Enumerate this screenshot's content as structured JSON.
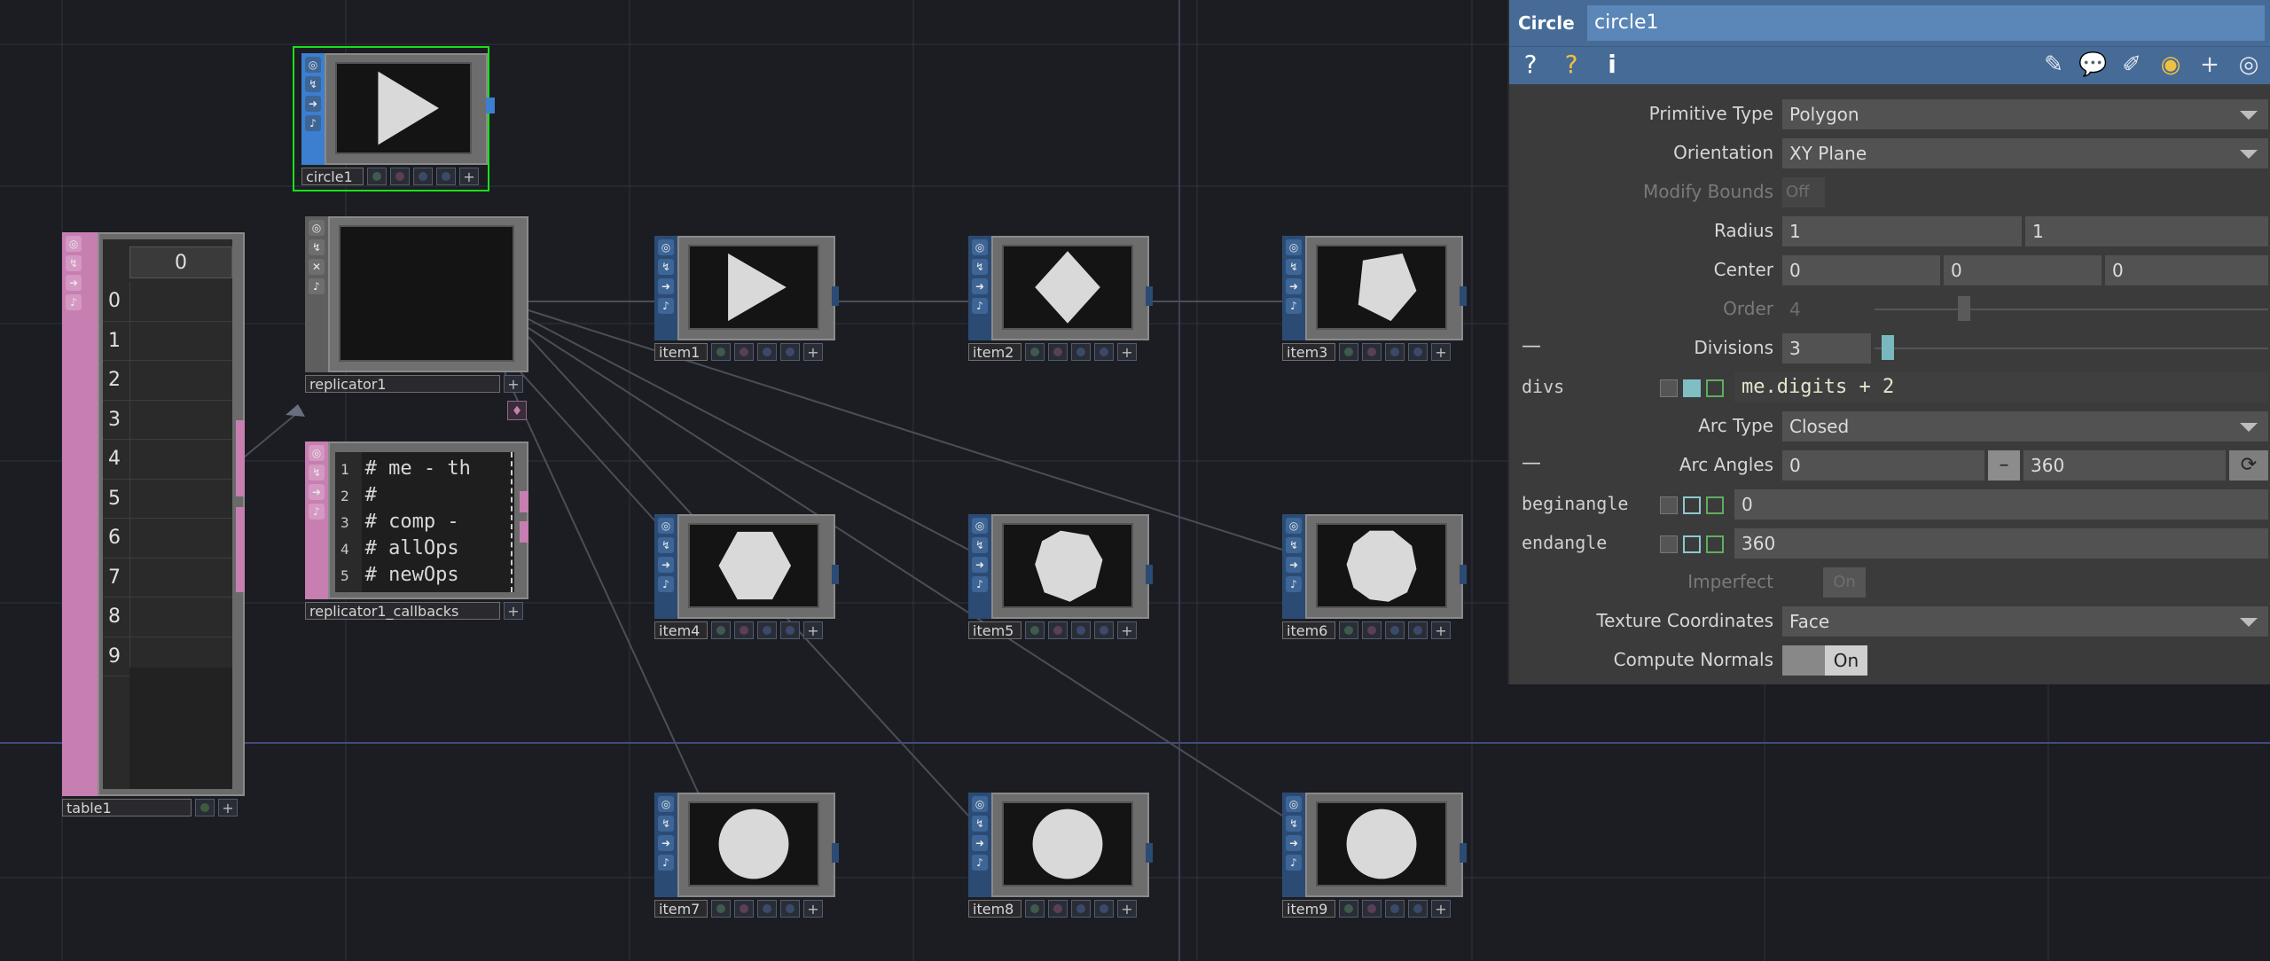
{
  "network": {
    "nodes": {
      "circle1": {
        "name": "circle1"
      },
      "replicator1": {
        "name": "replicator1"
      },
      "callbacks": {
        "name": "replicator1_callbacks",
        "lines": [
          {
            "num": "1",
            "text": "# me - th"
          },
          {
            "num": "2",
            "text": "#"
          },
          {
            "num": "3",
            "text": "# comp -"
          },
          {
            "num": "4",
            "text": "# allOps"
          },
          {
            "num": "5",
            "text": "# newOps"
          }
        ]
      },
      "table1": {
        "name": "table1",
        "header": "0",
        "rows": [
          "0",
          "1",
          "2",
          "3",
          "4",
          "5",
          "6",
          "7",
          "8",
          "9"
        ]
      },
      "items": [
        {
          "name": "item1",
          "shape": "triangle"
        },
        {
          "name": "item2",
          "shape": "diamond"
        },
        {
          "name": "item3",
          "shape": "pentagon"
        },
        {
          "name": "item4",
          "shape": "hexagon"
        },
        {
          "name": "item5",
          "shape": "heptagon"
        },
        {
          "name": "item6",
          "shape": "octagon"
        },
        {
          "name": "item7",
          "shape": "nonagon"
        },
        {
          "name": "item8",
          "shape": "decagon"
        },
        {
          "name": "item9",
          "shape": "hendecagon"
        }
      ]
    }
  },
  "params": {
    "op_type": "Circle",
    "op_name": "circle1",
    "toolbar": {
      "help": "?",
      "python_help": "?",
      "info": "i"
    },
    "primitive_type": {
      "label": "Primitive Type",
      "value": "Polygon"
    },
    "orientation": {
      "label": "Orientation",
      "value": "XY Plane"
    },
    "modify_bounds": {
      "label": "Modify Bounds",
      "value": "Off"
    },
    "radius": {
      "label": "Radius",
      "x": "1",
      "y": "1"
    },
    "center": {
      "label": "Center",
      "x": "0",
      "y": "0",
      "z": "0"
    },
    "order": {
      "label": "Order",
      "value": "4"
    },
    "divisions": {
      "label": "Divisions",
      "value": "3",
      "expr_name": "divs",
      "expr": "me.digits + 2"
    },
    "arc_type": {
      "label": "Arc Type",
      "value": "Closed"
    },
    "arc_angles": {
      "label": "Arc Angles",
      "begin": "0",
      "end": "360",
      "begin_name": "beginangle",
      "begin_expr": "0",
      "end_name": "endangle",
      "end_expr": "360"
    },
    "imperfect": {
      "label": "Imperfect",
      "value": "On"
    },
    "texture_coordinates": {
      "label": "Texture Coordinates",
      "value": "Face"
    },
    "compute_normals": {
      "label": "Compute Normals",
      "value": "On"
    }
  },
  "colors": {
    "sop": "#2c4b74",
    "dat": "#c77fb2",
    "selected": "#19e019",
    "header": "#466b97"
  }
}
